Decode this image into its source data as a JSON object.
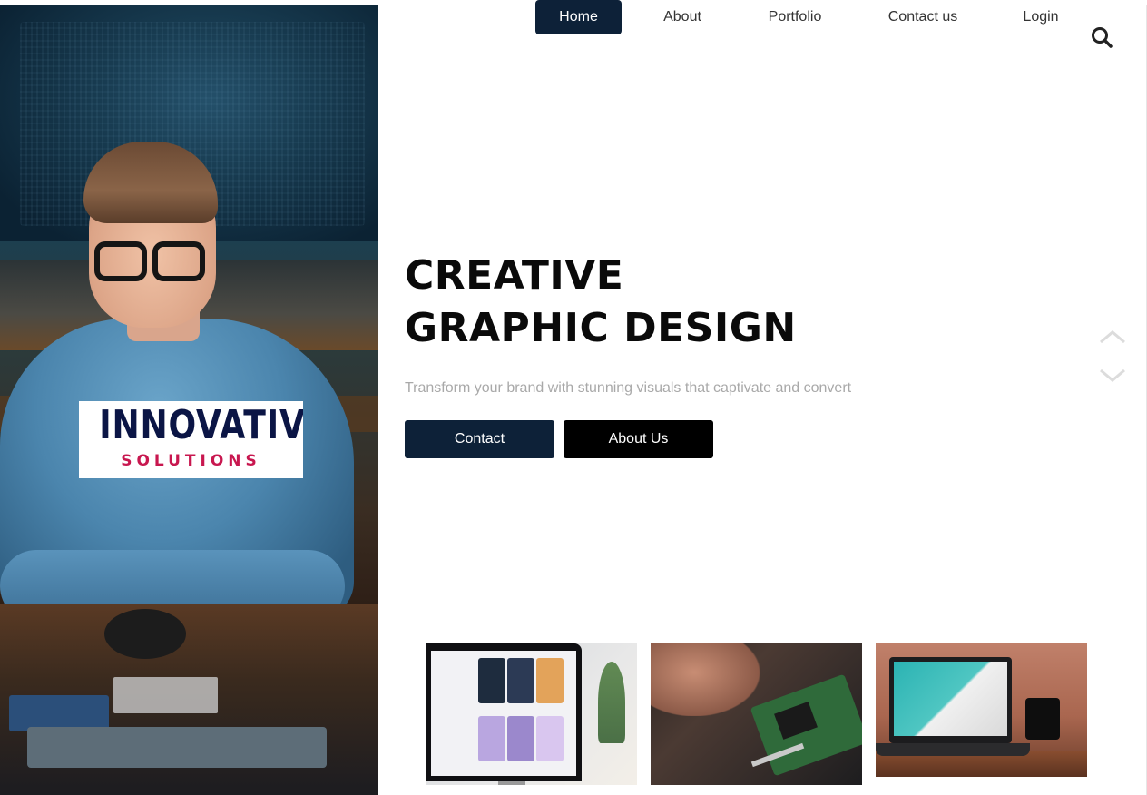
{
  "nav": {
    "items": [
      {
        "label": "Home",
        "active": true
      },
      {
        "label": "About",
        "active": false
      },
      {
        "label": "Portfolio",
        "active": false
      },
      {
        "label": "Contact us",
        "active": false
      },
      {
        "label": "Login",
        "active": false
      }
    ],
    "search_icon": "search-icon"
  },
  "logo": {
    "main": "INNOVATIVE",
    "sub": "SOLUTIONS"
  },
  "hero": {
    "title_line1": "CREATIVE",
    "title_line2": "GRAPHIC DESIGN",
    "subtitle": "Transform your brand with stunning visuals that captivate and convert",
    "contact_button": "Contact",
    "about_button": "About Us"
  },
  "slider": {
    "up_icon": "chevron-up-icon",
    "down_icon": "chevron-down-icon"
  },
  "colors": {
    "navy": "#0d2138",
    "black": "#000000",
    "logo_navy": "#0b1545",
    "logo_pink": "#c8174f",
    "subtitle_gray": "#a9a9a9"
  }
}
